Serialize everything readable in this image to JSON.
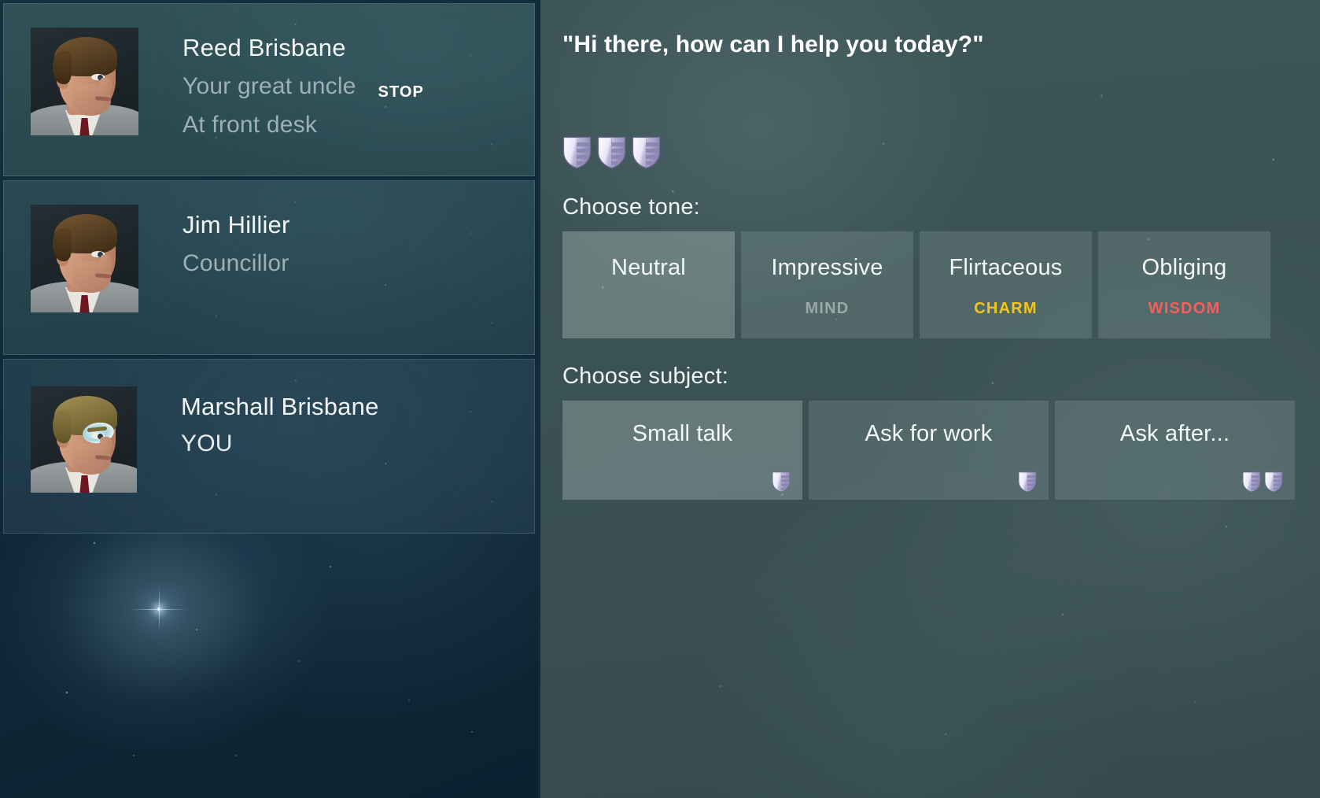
{
  "characters": [
    {
      "name": "Reed Brisbane",
      "relation": "Your great uncle",
      "location": "At front desk",
      "action_label": "STOP",
      "portrait_name": "reed-brisbane-portrait"
    },
    {
      "name": "Jim Hillier",
      "relation": "Councillor",
      "location": "",
      "action_label": "",
      "portrait_name": "jim-hillier-portrait"
    },
    {
      "name": "Marshall Brisbane",
      "relation": "YOU",
      "location": "",
      "action_label": "",
      "portrait_name": "marshall-brisbane-portrait"
    }
  ],
  "dialogue": {
    "line": "\"Hi there, how can I help you today?\"",
    "shield_count": 3,
    "shield_icon": "shield-crest-icon"
  },
  "tone": {
    "prompt": "Choose tone:",
    "options": [
      {
        "label": "Neutral",
        "stat": "",
        "stat_color": "",
        "selected": true
      },
      {
        "label": "Impressive",
        "stat": "MIND",
        "stat_color": "#9aa8a6",
        "selected": false
      },
      {
        "label": "Flirtaceous",
        "stat": "CHARM",
        "stat_color": "#f5c518",
        "selected": false
      },
      {
        "label": "Obliging",
        "stat": "WISDOM",
        "stat_color": "#f4605c",
        "selected": false
      }
    ]
  },
  "subject": {
    "prompt": "Choose subject:",
    "options": [
      {
        "label": "Small talk",
        "shields": 1,
        "selected": true
      },
      {
        "label": "Ask for work",
        "shields": 1,
        "selected": false
      },
      {
        "label": "Ask after...",
        "shields": 2,
        "selected": false
      }
    ]
  },
  "colors": {
    "panel_teal": "#3d5356",
    "card_teal": "#345256",
    "space_navy": "#0d2433",
    "text_primary": "#f2f5f6",
    "text_muted": "#9fb0b2",
    "charm": "#f5c518",
    "wisdom": "#f4605c",
    "mind": "#9aa8a6",
    "shield": "#d5d3ef"
  }
}
